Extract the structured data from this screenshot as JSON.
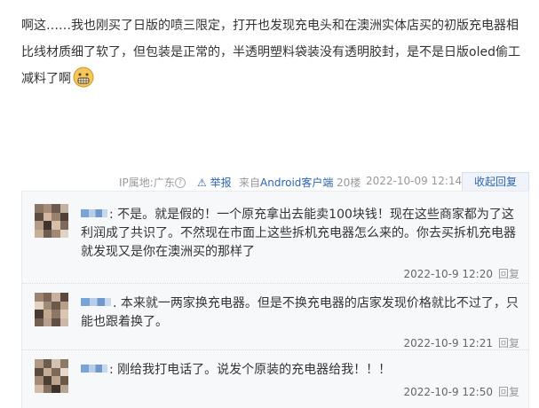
{
  "post": {
    "text": "啊这……我也刚买了日版的喷三限定，打开也发现充电头和在澳洲实体店买的初版充电器相比线材质细了软了，但包装是正常的，半透明塑料袋装没有透明胶封，是不是日版oled偷工减料了啊",
    "emoji_icon": "grimacing-face-icon"
  },
  "meta": {
    "ip": "IP属地:广东",
    "report": "举报",
    "source_prefix": "来自",
    "source_link": "Android客户端",
    "floor": "20楼",
    "datetime": "2022-10-09 12:14",
    "collapse_reply": "收起回复"
  },
  "replies": [
    {
      "text": ": 不是。就是假的！一个原充拿出去能卖100块钱！现在这些商家都为了这利润成了共识了。不然现在市面上这些拆机充电器怎么来的。你去买拆机充电器就发现又是你在澳洲买的那样了",
      "time": "2022-10-9 12:20",
      "reply": "回复"
    },
    {
      "text": ". 本来就一两家换充电器。但是不换充电器的店家发现价格就比不过了，只能也跟着换了。",
      "time": "2022-10-9 12:21",
      "reply": "回复"
    },
    {
      "text": ": 刚给我打电话了。说发个原装的充电器给我！！！",
      "time": "2022-10-9 12:50",
      "reply": "回复"
    }
  ],
  "colors": {
    "link": "#2d64b3",
    "meta_gray": "#999999",
    "reply_bg": "#f7f8fa"
  }
}
